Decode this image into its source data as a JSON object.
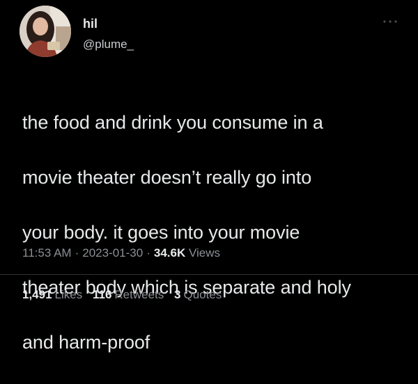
{
  "user": {
    "display_name": "hil",
    "handle": "@plume_",
    "avatar_icon": "profile-photo"
  },
  "tweet": {
    "text_lines": [
      "the food and drink you consume in a",
      "movie theater doesn’t really go into",
      "your body. it goes into your movie",
      "theater body which is separate and holy",
      "and harm-proof"
    ]
  },
  "meta": {
    "time": "11:53 AM",
    "separator": "·",
    "date": "2023-01-30",
    "views_count": "34.6K",
    "views_label": "Views"
  },
  "stats": {
    "likes_count": "1,491",
    "likes_label": "Likes",
    "retweets_count": "116",
    "retweets_label": "Retweets",
    "quotes_count": "3",
    "quotes_label": "Quotes"
  },
  "colors": {
    "background": "#000000",
    "primary_text": "#e7e9ea",
    "secondary_text": "#8b8f94",
    "divider": "#2f3336"
  },
  "icons": {
    "more": "more-options-icon"
  }
}
